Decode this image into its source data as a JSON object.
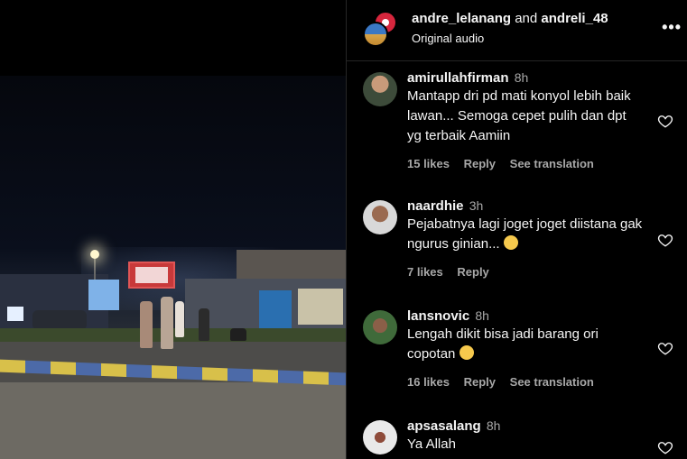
{
  "header": {
    "user1": "andre_lelanang",
    "and_text": "and",
    "user2": "andreli_48",
    "audio": "Original audio",
    "more_icon": "more-horizontal-icon"
  },
  "comments": [
    {
      "username": "amirullahfirman",
      "time": "8h",
      "text": "Mantapp dri pd mati konyol lebih baik lawan... Semoga cepet pulih dan dpt yg terbaik Aamiin",
      "likes": "15 likes",
      "reply": "Reply",
      "translate": "See translation"
    },
    {
      "username": "naardhie",
      "time": "3h",
      "text": "Pejabatnya lagi joget joget diistana gak ngurus ginian...",
      "emoji": "flushed-face-emoji",
      "likes": "7 likes",
      "reply": "Reply"
    },
    {
      "username": "lansnovic",
      "time": "8h",
      "text": "Lengah dikit bisa jadi barang ori copotan",
      "emoji": "laughing-face-emoji",
      "likes": "16 likes",
      "reply": "Reply",
      "translate": "See translation"
    },
    {
      "username": "apsasalang",
      "time": "8h",
      "text": "Ya Allah"
    }
  ],
  "icons": {
    "like": "heart-outline-icon"
  },
  "colors": {
    "background": "#000000",
    "text_primary": "#f5f5f5",
    "text_secondary": "#a8a8a8",
    "divider": "#262626"
  }
}
